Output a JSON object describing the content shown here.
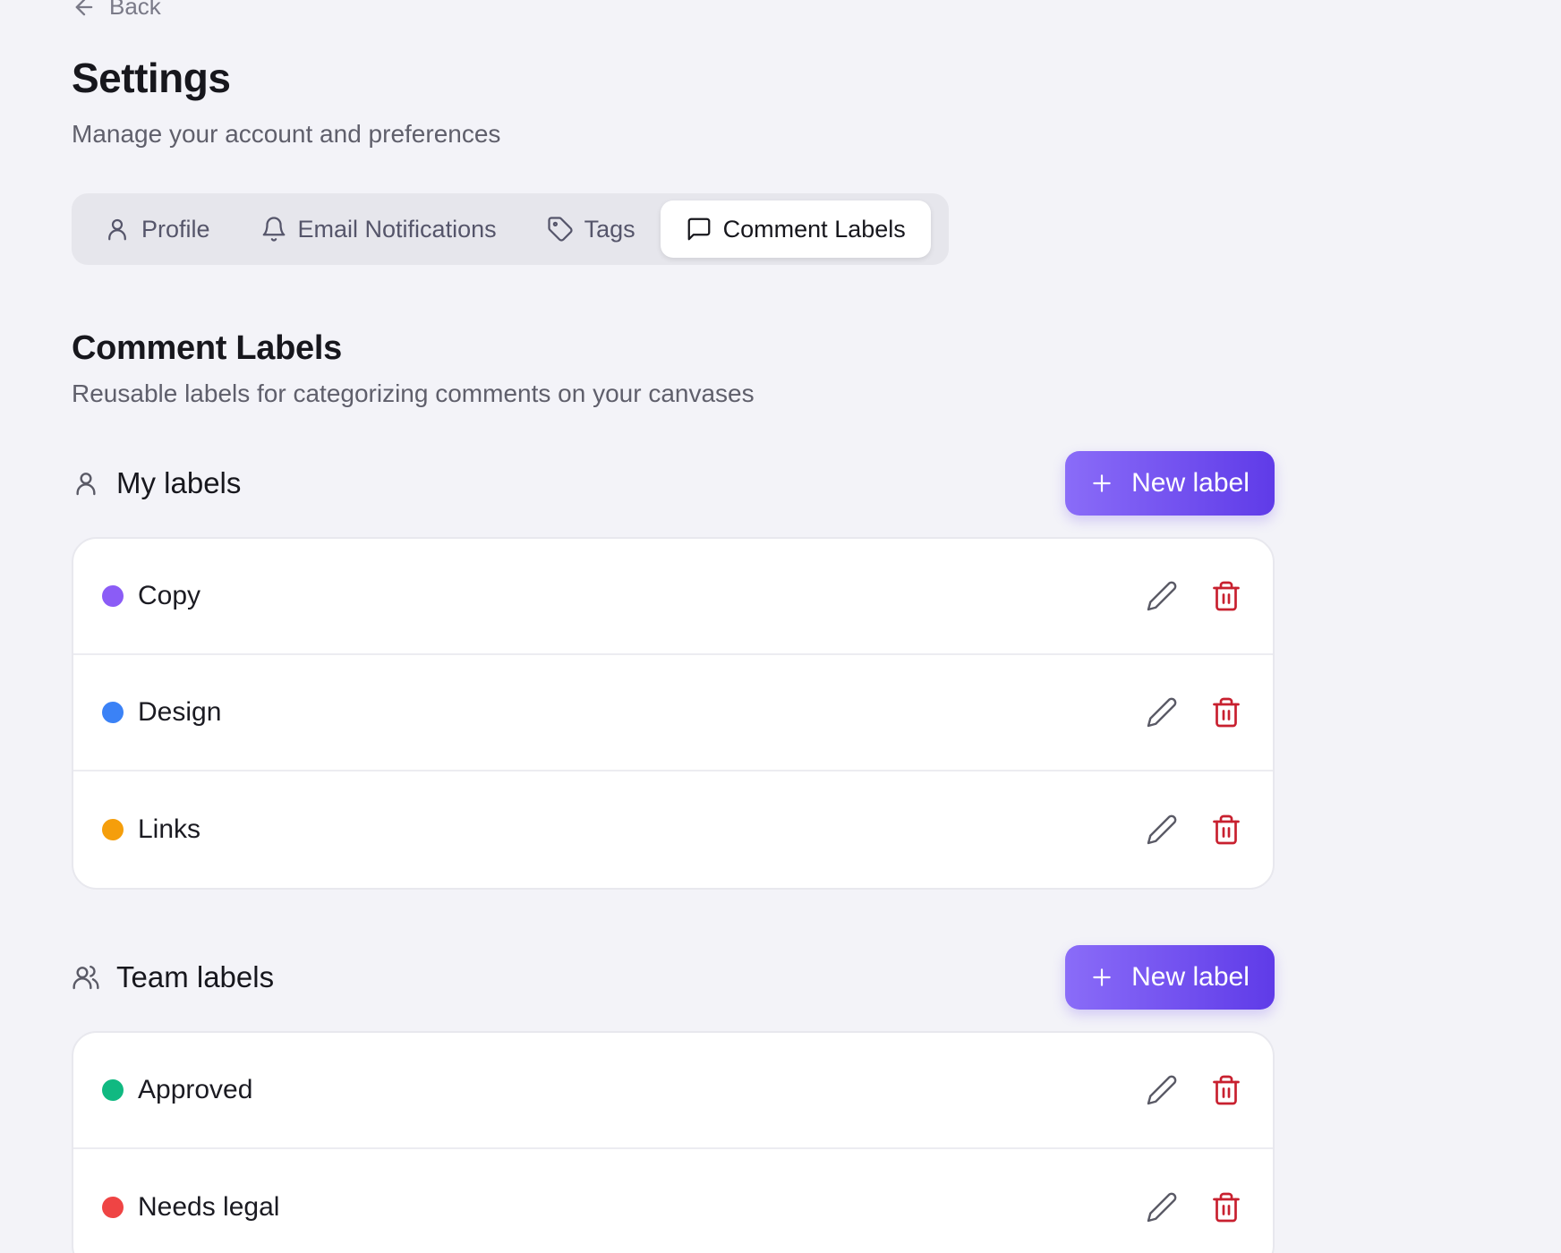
{
  "nav": {
    "back_label": "Back"
  },
  "header": {
    "title": "Settings",
    "subtitle": "Manage your account and preferences"
  },
  "tabs": [
    {
      "label": "Profile",
      "icon": "user-icon",
      "active": false
    },
    {
      "label": "Email Notifications",
      "icon": "bell-icon",
      "active": false
    },
    {
      "label": "Tags",
      "icon": "tag-icon",
      "active": false
    },
    {
      "label": "Comment Labels",
      "icon": "message-square-icon",
      "active": true
    }
  ],
  "section": {
    "title": "Comment Labels",
    "subtitle": "Reusable labels for categorizing comments on your canvases"
  },
  "my_labels": {
    "title": "My labels",
    "new_button": "New label",
    "items": [
      {
        "name": "Copy",
        "color": "#8b5cf6"
      },
      {
        "name": "Design",
        "color": "#3b82f6"
      },
      {
        "name": "Links",
        "color": "#f59e0b"
      }
    ]
  },
  "team_labels": {
    "title": "Team labels",
    "new_button": "New label",
    "items": [
      {
        "name": "Approved",
        "color": "#10b981"
      },
      {
        "name": "Needs legal",
        "color": "#ef4444"
      }
    ]
  },
  "colors": {
    "accent_start": "#8a6cf8",
    "accent_end": "#5f3be8",
    "delete_icon": "#c8202f",
    "edit_icon": "#5a5a66"
  }
}
